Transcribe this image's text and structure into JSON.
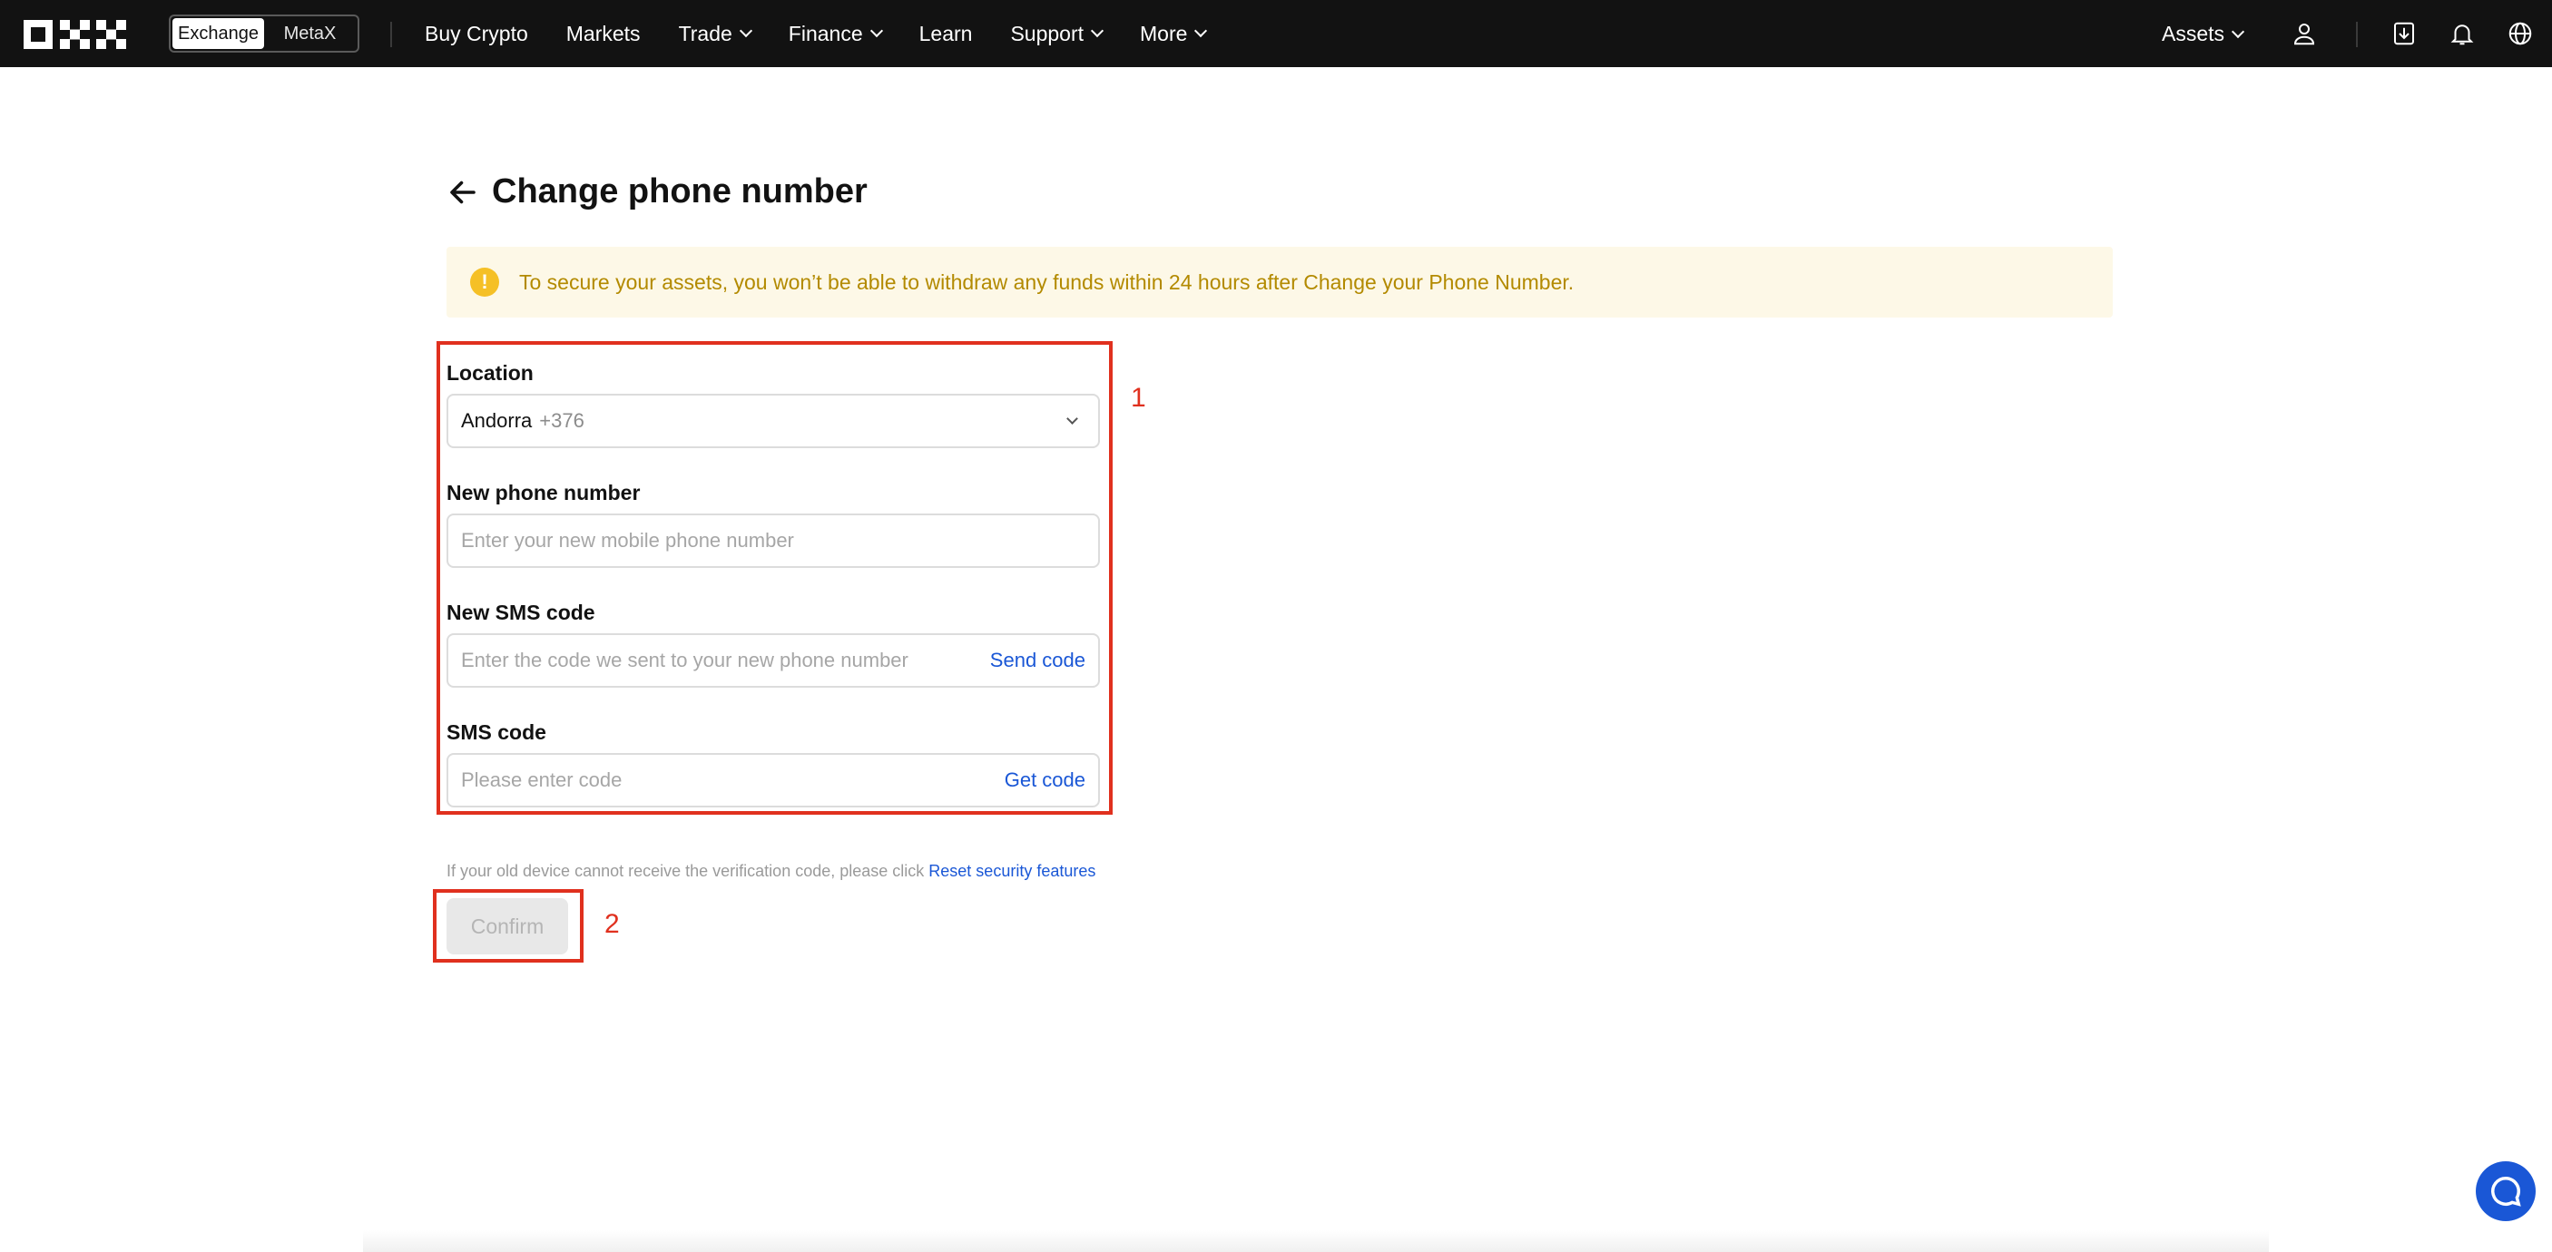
{
  "nav": {
    "logo": "OKX",
    "seg": [
      "Exchange",
      "MetaX"
    ],
    "items": [
      "Buy Crypto",
      "Markets",
      "Trade",
      "Finance",
      "Learn",
      "Support",
      "More"
    ],
    "assets": "Assets"
  },
  "page": {
    "title": "Change phone number",
    "alert": "To secure your assets, you won’t be able to withdraw any funds within 24 hours after Change your Phone Number."
  },
  "form": {
    "location_label": "Location",
    "location_value": "Andorra",
    "location_code": "+376",
    "phone_label": "New phone number",
    "phone_placeholder": "Enter your new mobile phone number",
    "new_sms_label": "New SMS code",
    "new_sms_placeholder": "Enter the code we sent to your new phone number",
    "send_code": "Send code",
    "sms_label": "SMS code",
    "sms_placeholder": "Please enter code",
    "get_code": "Get code",
    "hint": "If your old device cannot receive the verification code, please click ",
    "hint_link": "Reset security features",
    "confirm": "Confirm"
  },
  "annotations": [
    "1",
    "2"
  ],
  "colors": {
    "accent": "#1a57d6",
    "annotation": "#e0301e",
    "alert_bg": "#fdf8e7",
    "alert_text": "#b38a00"
  }
}
